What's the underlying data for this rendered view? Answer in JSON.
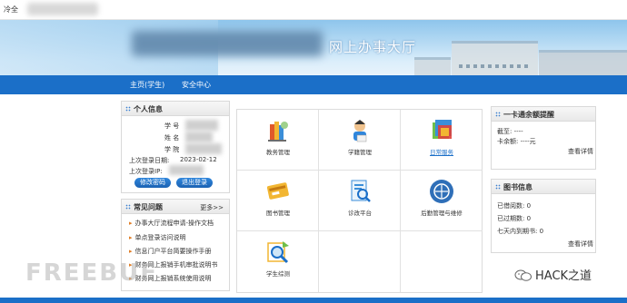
{
  "browser": {
    "tab_label": "冷全"
  },
  "banner": {
    "title": "网上办事大厅"
  },
  "nav": {
    "items": [
      "主页(学生)",
      "安全中心"
    ]
  },
  "personal": {
    "title": "个人信息",
    "fields": [
      {
        "label": "学  号",
        "value": ""
      },
      {
        "label": "姓  名",
        "value": ""
      },
      {
        "label": "学  院",
        "value": ""
      }
    ],
    "last_login_date_label": "上次登录日期:",
    "last_login_date": "2023-02-12",
    "last_login_ip_label": "上次登录IP:",
    "buttons": {
      "change_password": "修改密码",
      "logout": "退出登录"
    }
  },
  "faq": {
    "title": "常见问题",
    "more": "更多>>",
    "items": [
      "办事大厅流程申请-操作文档",
      "单点登录访问说明",
      "信息门户平台简要操作手册",
      "财务网上报销手机审批说明书",
      "财务网上报销系统使用说明"
    ]
  },
  "apps": [
    {
      "label": "教务管理",
      "icon": "books-icon"
    },
    {
      "label": "学籍管理",
      "icon": "student-icon"
    },
    {
      "label": "日常服务",
      "icon": "windows-icon",
      "color": "#1b6fc8"
    },
    {
      "label": "图书管理",
      "icon": "card-icon"
    },
    {
      "label": "诊改平台",
      "icon": "search-doc-icon"
    },
    {
      "label": "后勤管理与维修",
      "icon": "basketball-icon"
    },
    {
      "label": "学生综测",
      "icon": "magnifier-icon"
    }
  ],
  "card": {
    "title": "一卡通余额提醒",
    "lines": [
      "截至:  ----",
      "卡余额: ----元"
    ],
    "detail": "查看详情"
  },
  "library": {
    "title": "图书信息",
    "lines": [
      "已借阅数: 0",
      "已过期数: 0",
      "七天内到期书: 0"
    ],
    "detail": "查看详情"
  },
  "branding": {
    "watermark": "FREEBUF",
    "account": "HACK之道"
  }
}
